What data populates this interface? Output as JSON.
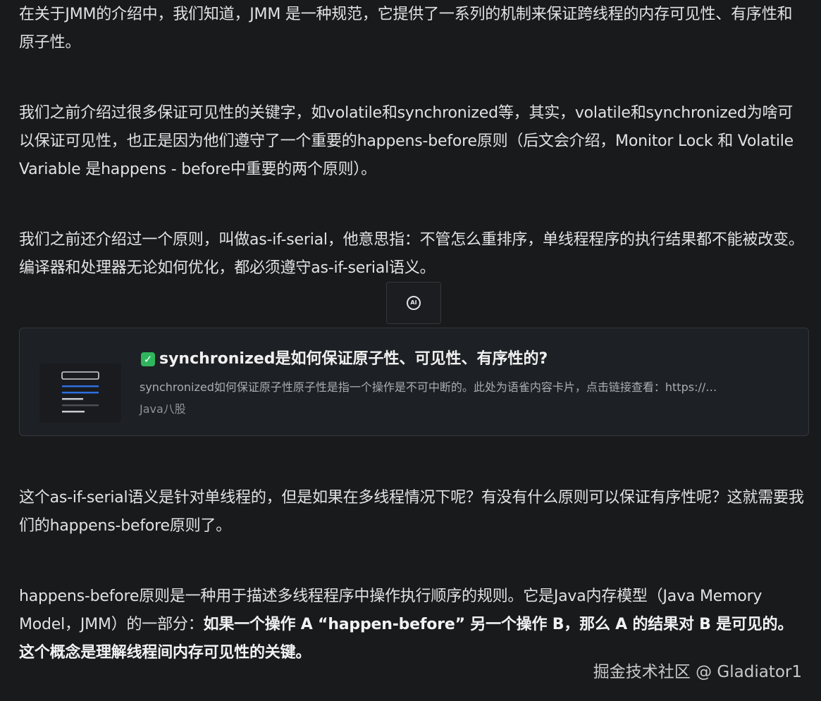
{
  "paragraphs": {
    "p1": "在关于JMM的介绍中，我们知道，JMM 是一种规范，它提供了一系列的机制来保证跨线程的内存可见性、有序性和原子性。",
    "p2": "我们之前介绍过很多保证可见性的关键字，如volatile和synchronized等，其实，volatile和synchronized为啥可以保证可见性，也正是因为他们遵守了一个重要的happens-before原则（后文会介绍，Monitor Lock 和 Volatile Variable 是happens - before中重要的两个原则）。",
    "p3": "我们之前还介绍过一个原则，叫做as-if-serial，他意思指：不管怎么重排序，单线程程序的执行结果都不能被改变。编译器和处理器无论如何优化，都必须遵守as-if-serial语义。",
    "p4": "这个as-if-serial语义是针对单线程的，但是如果在多线程情况下呢？有没有什么原则可以保证有序性呢？这就需要我们的happens-before原则了。",
    "p5_plain": "happens-before原则是一种用于描述多线程程序中操作执行顺序的规则。它是Java内存模型（Java Memory Model，JMM）的一部分：",
    "p5_bold": "如果一个操作 A “happen-before” 另一个操作 B，那么 A 的结果对 B 是可见的。这个概念是理解线程间内存可见性的关键。"
  },
  "ai_button": {
    "label": "AI",
    "icon": "ai-icon"
  },
  "card": {
    "title": "synchronized是如何保证原子性、可见性、有序性的?",
    "description": "synchronized如何保证原子性原子性是指一个操作是不可中断的。此处为语雀内容卡片，点击链接查看：https://…",
    "source": "Java八股",
    "icon": "check-icon",
    "accent": "#2fb65d"
  },
  "watermark": "掘金技术社区 @ Gladiator1"
}
